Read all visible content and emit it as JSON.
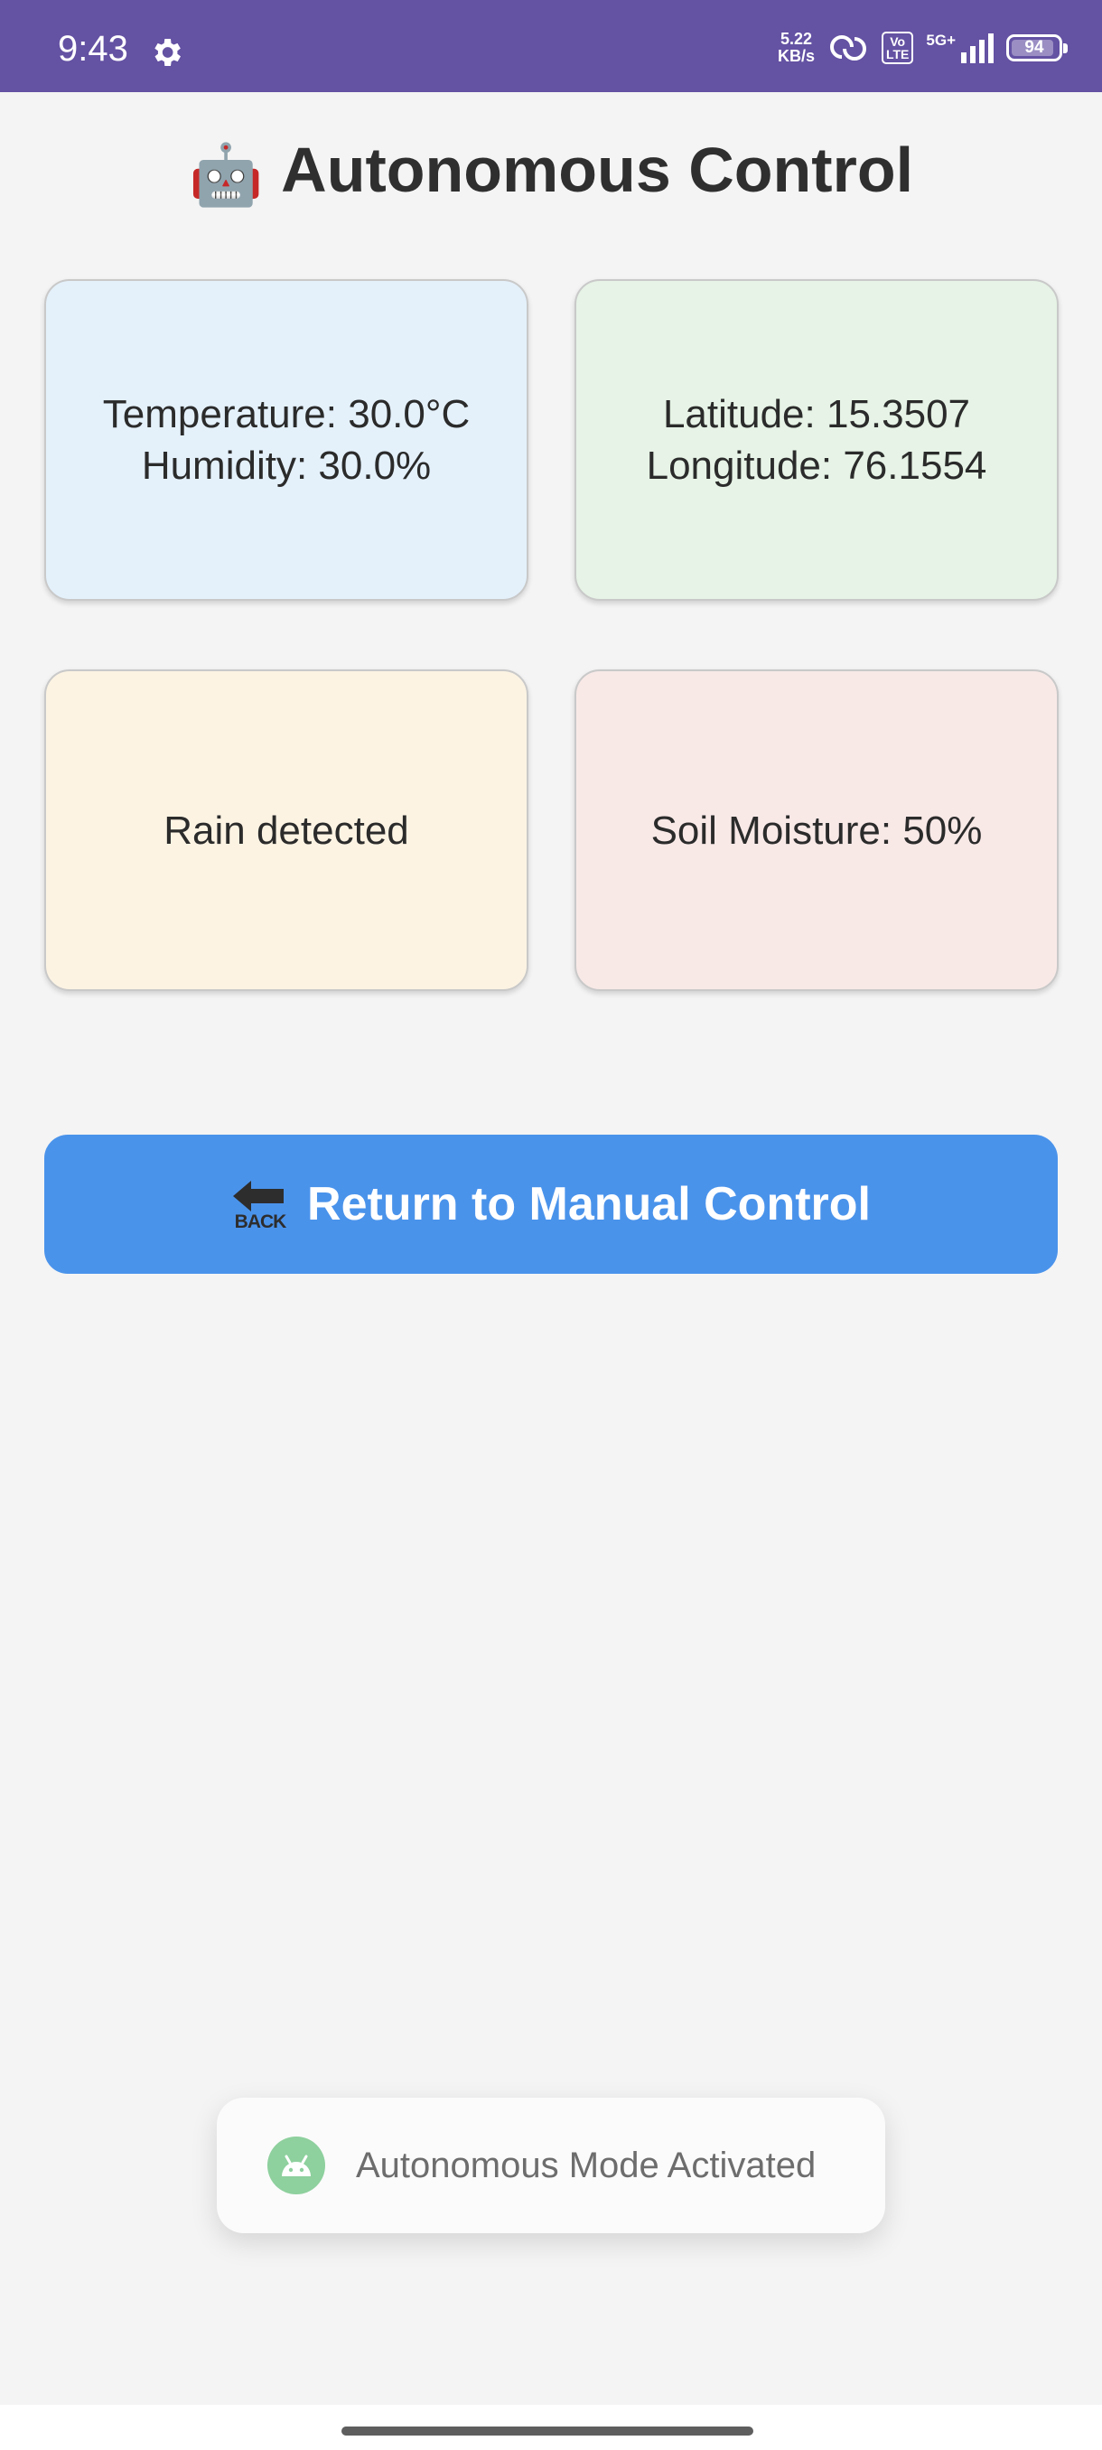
{
  "status_bar": {
    "time": "9:43",
    "network_speed_value": "5.22",
    "network_speed_unit": "KB/s",
    "volte_top": "Vo",
    "volte_bottom": "LTE",
    "network_type": "5G+",
    "signal_bars": 4,
    "battery": "94",
    "icons": [
      "gear-icon",
      "hotspot-link-icon",
      "volte-icon",
      "signal-icon",
      "battery-icon"
    ],
    "background": "#6452a3"
  },
  "header": {
    "emoji": "🤖",
    "title": "Autonomous Control"
  },
  "cards": {
    "weather": {
      "line1": "Temperature: 30.0°C",
      "line2": "Humidity: 30.0%",
      "color": "#e4f1fb"
    },
    "location": {
      "line1": "Latitude: 15.3507",
      "line2": "Longitude: 76.1554",
      "color": "#e6f3e6"
    },
    "rain": {
      "text": "Rain detected",
      "color": "#fcf3e3"
    },
    "soil": {
      "text": "Soil Moisture: 50%",
      "color": "#f8e9e7"
    }
  },
  "actions": {
    "back_icon_label": "BACK",
    "return_label": "Return to Manual Control",
    "color": "#4a93eb"
  },
  "toast": {
    "message": "Autonomous Mode Activated",
    "icon": "android-icon"
  }
}
